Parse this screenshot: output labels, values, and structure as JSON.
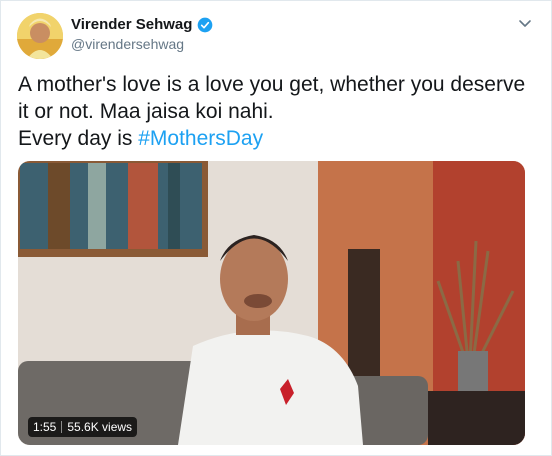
{
  "tweet": {
    "display_name": "Virender Sehwag",
    "handle": "@virendersehwag",
    "text_line1": "A mother's love is a love you get, whether you deserve",
    "text_line2": "it or not. Maa jaisa koi nahi.",
    "text_line3_prefix": "Every day is ",
    "hashtag": "#MothersDay"
  },
  "video": {
    "duration": "1:55",
    "views": "55.6K views"
  },
  "colors": {
    "link": "#1da1f2",
    "verified": "#1da1f2",
    "text": "#14171a",
    "secondary": "#657786"
  },
  "icons": {
    "verified": "verified-badge-icon",
    "caret": "chevron-down-icon"
  }
}
